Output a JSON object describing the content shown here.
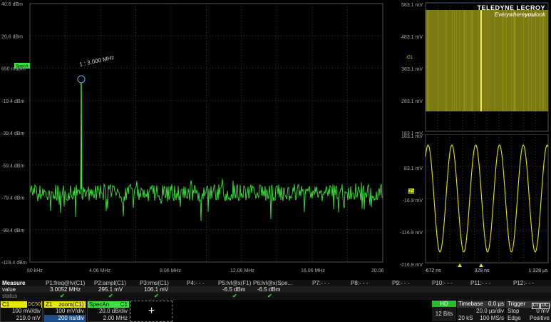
{
  "spectrum": {
    "y_labels": [
      "40.6 dBm",
      "20.6 dBm",
      "650 mdBm",
      "-19.4 dBm",
      "-39.4 dBm",
      "-59.4 dBm",
      "-79.4 dBm",
      "-99.4 dBm",
      "-119.4 dBm"
    ],
    "x_labels": [
      "60 kHz",
      "4.06 MHz",
      "8.06 MHz",
      "12.06 MHz",
      "16.06 MHz",
      "20.06 MHz"
    ],
    "marker_label": "1 : 3.000 MHz",
    "trace_tag": "SpecA",
    "trace_color": "#39e639"
  },
  "zoom": {
    "y_labels": [
      "583.1 mV",
      "483.1 mV",
      "383.1 mV",
      "283.1 mV",
      "183.1 mV",
      "83.1 mV",
      "-16.9 mV",
      "-116.9 mV",
      "-216.9 mV"
    ],
    "x_labels": [
      "-672 ns",
      "328 ns",
      "1.328 µs"
    ],
    "trace_tag": "C1",
    "ch_tag": "Z1",
    "trace_color": "#e8e800"
  },
  "logo": {
    "brand": "TELEDYNE LECROY",
    "tagline_pre": "Everywhere",
    "tagline_bold": "you",
    "tagline_post": "look"
  },
  "measure": {
    "headers": [
      "Measure",
      "P1:freq@lv(C1)",
      "P2:ampl(C1)",
      "P3:rms(C1)",
      "P4:- - -",
      "P5:lvl@x(F1)",
      "P6:lvl@x(Spe...",
      "P7:- - -",
      "P8:- - -",
      "P9:- - -",
      "P10:- - -",
      "P11:- - -",
      "P12:- - -"
    ],
    "values": [
      "value",
      "3.0052 MHz",
      "295.1 mV",
      "106.1 mV",
      "",
      "-6.5 dBm",
      "-6.5 dBm",
      "",
      "",
      "",
      "",
      "",
      ""
    ],
    "status": [
      "status",
      "✔",
      "✔",
      "✔",
      "",
      "✔",
      "✔",
      "",
      "",
      "",
      "",
      "",
      ""
    ]
  },
  "descriptors": {
    "c1": {
      "name": "C1",
      "coupling": "DC50",
      "scale": "100 mV/div",
      "offset": "219.0 mV"
    },
    "z1": {
      "name": "Z1",
      "label": "zoom(C1)",
      "scale": "100 mV/div",
      "time": "200 ns/div"
    },
    "spec": {
      "name": "SpecAn",
      "src": "C1",
      "scale": "20.0 dB/div",
      "span": "2.00 MHz"
    },
    "add": "+"
  },
  "hd": {
    "label": "HD",
    "bits": "12 Bits"
  },
  "timebase": {
    "label": "Timebase",
    "delay": "0.0 µs",
    "per_div": "20.0 µs/div",
    "samples": "20 kS",
    "rate": "100 MS/s"
  },
  "trigger": {
    "label": "Trigger",
    "b1": "C1",
    "b2": "DC",
    "mode": "Stop",
    "level": "0 mV",
    "type": "Edge",
    "slope": "Positive"
  }
}
